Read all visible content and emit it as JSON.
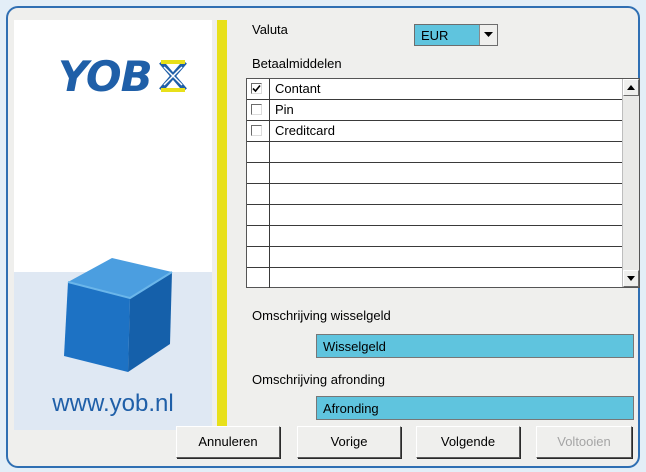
{
  "brand": {
    "logo_text": "YOB",
    "url": "www.yob.nl"
  },
  "form": {
    "currency_label": "Valuta",
    "currency_value": "EUR",
    "payment_methods_label": "Betaalmiddelen",
    "payment_methods": [
      {
        "label": "Contant",
        "checked": true
      },
      {
        "label": "Pin",
        "checked": false
      },
      {
        "label": "Creditcard",
        "checked": false
      },
      {
        "label": "",
        "checked": false
      },
      {
        "label": "",
        "checked": false
      },
      {
        "label": "",
        "checked": false
      },
      {
        "label": "",
        "checked": false
      },
      {
        "label": "",
        "checked": false
      },
      {
        "label": "",
        "checked": false
      }
    ],
    "change_desc_label": "Omschrijving wisselgeld",
    "change_desc_value": "Wisselgeld",
    "rounding_desc_label": "Omschrijving afronding",
    "rounding_desc_value": "Afronding"
  },
  "buttons": {
    "cancel": "Annuleren",
    "previous": "Vorige",
    "next": "Volgende",
    "finish": "Voltooien"
  },
  "colors": {
    "field_bg": "#5fc4de",
    "brand_blue": "#1f5fa8",
    "accent_yellow": "#e8e01a"
  },
  "icons": {
    "dropdown": "chevron-down-icon",
    "scroll_up": "arrow-up-icon",
    "scroll_down": "arrow-down-icon",
    "checkbox": "checkmark-icon"
  }
}
